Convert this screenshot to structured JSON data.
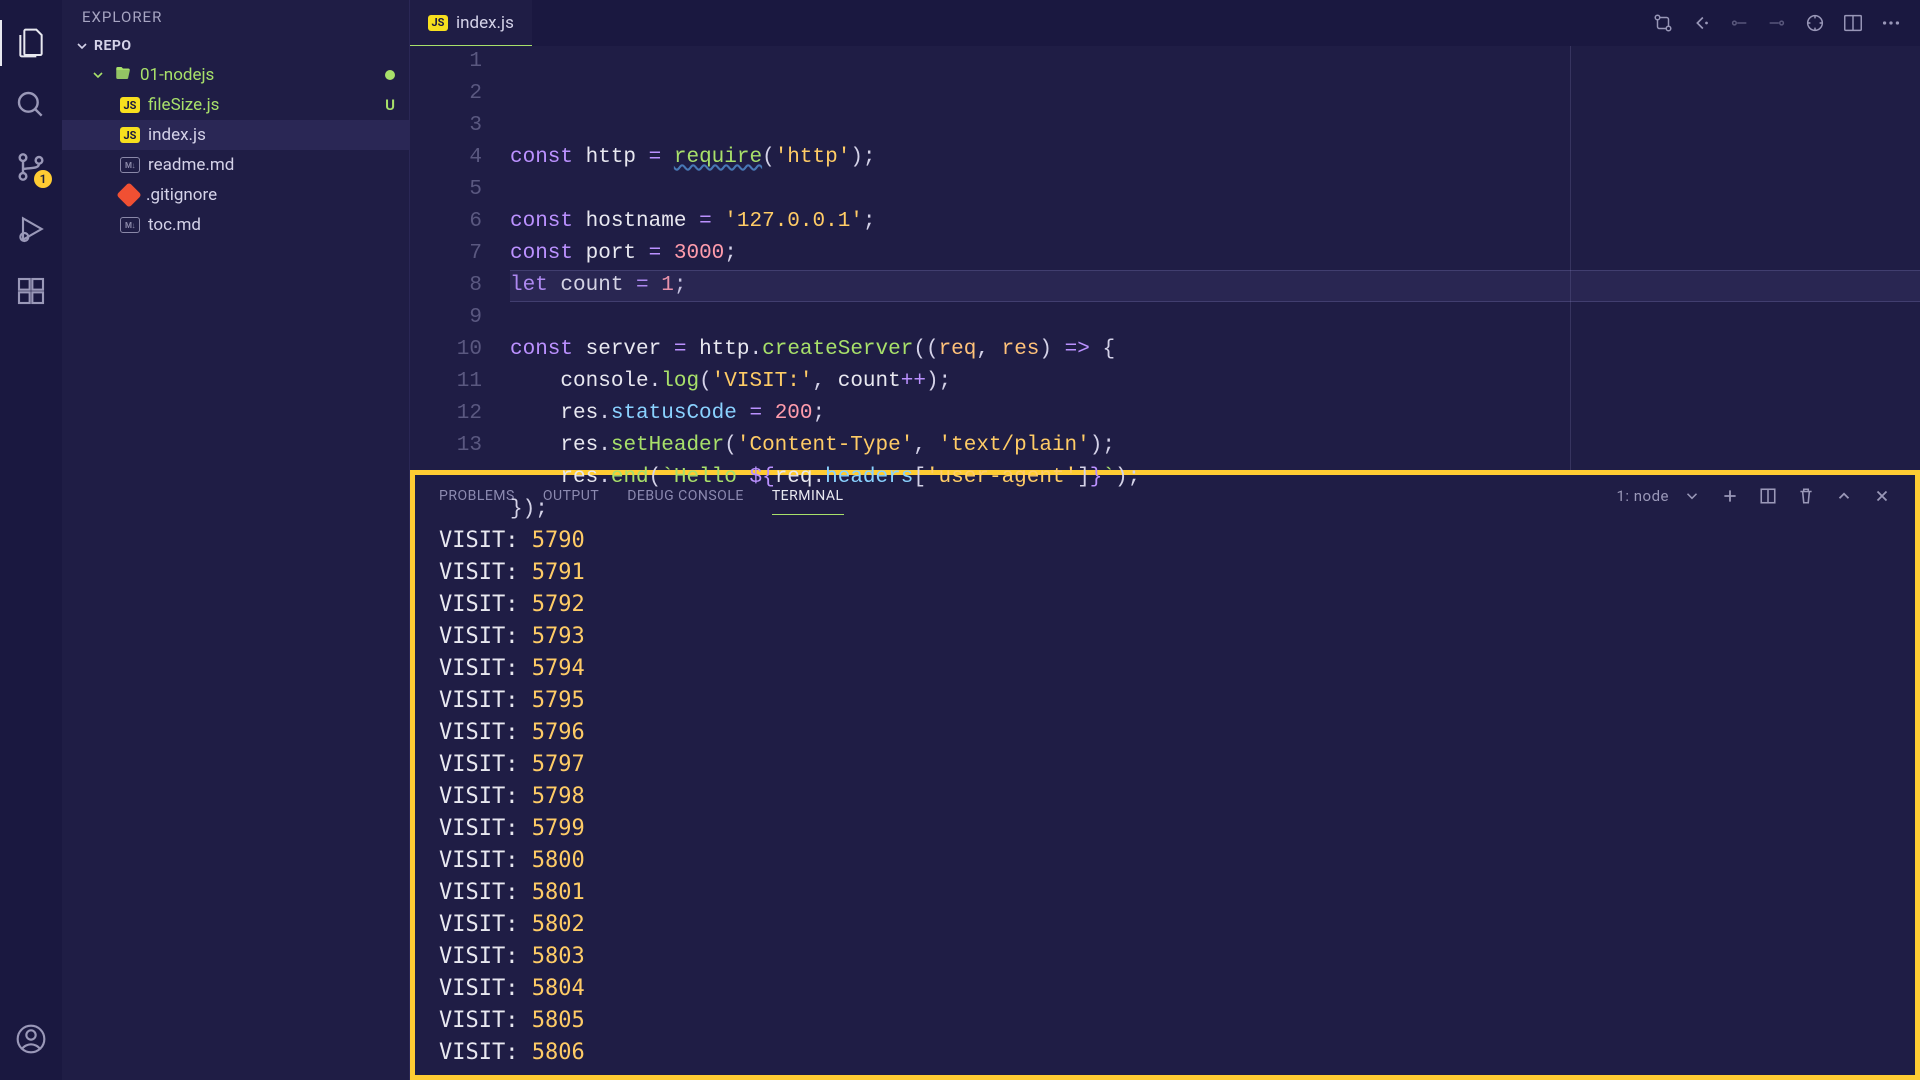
{
  "sidebar": {
    "title": "EXPLORER",
    "section": "REPO",
    "folder": "01-nodejs",
    "files": [
      {
        "icon": "js",
        "label": "fileSize.js",
        "status": "U"
      },
      {
        "icon": "js",
        "label": "index.js",
        "status": ""
      },
      {
        "icon": "md",
        "label": "readme.md",
        "status": ""
      },
      {
        "icon": "git",
        "label": ".gitignore",
        "status": ""
      },
      {
        "icon": "md",
        "label": "toc.md",
        "status": ""
      }
    ],
    "scm_badge": "1"
  },
  "tab": {
    "icon": "js",
    "label": "index.js"
  },
  "code_lines": [
    [
      {
        "t": "kw",
        "v": "const"
      },
      {
        "t": "",
        "v": " "
      },
      {
        "t": "var",
        "v": "http"
      },
      {
        "t": "",
        "v": " "
      },
      {
        "t": "op",
        "v": "="
      },
      {
        "t": "",
        "v": " "
      },
      {
        "t": "fn squig",
        "v": "require"
      },
      {
        "t": "",
        "v": "("
      },
      {
        "t": "str",
        "v": "'http'"
      },
      {
        "t": "",
        "v": ");"
      }
    ],
    [],
    [
      {
        "t": "kw",
        "v": "const"
      },
      {
        "t": "",
        "v": " "
      },
      {
        "t": "var",
        "v": "hostname"
      },
      {
        "t": "",
        "v": " "
      },
      {
        "t": "op",
        "v": "="
      },
      {
        "t": "",
        "v": " "
      },
      {
        "t": "str",
        "v": "'127.0.0.1'"
      },
      {
        "t": "",
        "v": ";"
      }
    ],
    [
      {
        "t": "kw",
        "v": "const"
      },
      {
        "t": "",
        "v": " "
      },
      {
        "t": "var",
        "v": "port"
      },
      {
        "t": "",
        "v": " "
      },
      {
        "t": "op",
        "v": "="
      },
      {
        "t": "",
        "v": " "
      },
      {
        "t": "num",
        "v": "3000"
      },
      {
        "t": "",
        "v": ";"
      }
    ],
    [
      {
        "t": "kw",
        "v": "let"
      },
      {
        "t": "",
        "v": " "
      },
      {
        "t": "var",
        "v": "count"
      },
      {
        "t": "",
        "v": " "
      },
      {
        "t": "op",
        "v": "="
      },
      {
        "t": "",
        "v": " "
      },
      {
        "t": "num",
        "v": "1"
      },
      {
        "t": "",
        "v": ";"
      }
    ],
    [],
    [
      {
        "t": "kw",
        "v": "const"
      },
      {
        "t": "",
        "v": " "
      },
      {
        "t": "var",
        "v": "server"
      },
      {
        "t": "",
        "v": " "
      },
      {
        "t": "op",
        "v": "="
      },
      {
        "t": "",
        "v": " "
      },
      {
        "t": "var",
        "v": "http"
      },
      {
        "t": "",
        "v": "."
      },
      {
        "t": "fn",
        "v": "createServer"
      },
      {
        "t": "",
        "v": "(("
      },
      {
        "t": "param",
        "v": "req"
      },
      {
        "t": "",
        "v": ", "
      },
      {
        "t": "param",
        "v": "res"
      },
      {
        "t": "",
        "v": ") "
      },
      {
        "t": "op",
        "v": "=>"
      },
      {
        "t": "",
        "v": " {"
      }
    ],
    [
      {
        "t": "",
        "v": "    "
      },
      {
        "t": "var",
        "v": "console"
      },
      {
        "t": "",
        "v": "."
      },
      {
        "t": "fn",
        "v": "log"
      },
      {
        "t": "",
        "v": "("
      },
      {
        "t": "str",
        "v": "'VISIT:'"
      },
      {
        "t": "",
        "v": ", "
      },
      {
        "t": "var",
        "v": "count"
      },
      {
        "t": "op",
        "v": "++"
      },
      {
        "t": "",
        "v": ");"
      }
    ],
    [
      {
        "t": "",
        "v": "    "
      },
      {
        "t": "var",
        "v": "res"
      },
      {
        "t": "",
        "v": "."
      },
      {
        "t": "prop",
        "v": "statusCode"
      },
      {
        "t": "",
        "v": " "
      },
      {
        "t": "op",
        "v": "="
      },
      {
        "t": "",
        "v": " "
      },
      {
        "t": "num",
        "v": "200"
      },
      {
        "t": "",
        "v": ";"
      }
    ],
    [
      {
        "t": "",
        "v": "    "
      },
      {
        "t": "var",
        "v": "res"
      },
      {
        "t": "",
        "v": "."
      },
      {
        "t": "fn",
        "v": "setHeader"
      },
      {
        "t": "",
        "v": "("
      },
      {
        "t": "str",
        "v": "'Content-Type'"
      },
      {
        "t": "",
        "v": ", "
      },
      {
        "t": "str",
        "v": "'text/plain'"
      },
      {
        "t": "",
        "v": ");"
      }
    ],
    [
      {
        "t": "",
        "v": "    "
      },
      {
        "t": "var",
        "v": "res"
      },
      {
        "t": "",
        "v": "."
      },
      {
        "t": "fn",
        "v": "end"
      },
      {
        "t": "",
        "v": "("
      },
      {
        "t": "tmpl",
        "v": "`Hello "
      },
      {
        "t": "op",
        "v": "${"
      },
      {
        "t": "var",
        "v": "req"
      },
      {
        "t": "",
        "v": "."
      },
      {
        "t": "prop",
        "v": "headers"
      },
      {
        "t": "",
        "v": "["
      },
      {
        "t": "str",
        "v": "'user-agent'"
      },
      {
        "t": "",
        "v": "]"
      },
      {
        "t": "op",
        "v": "}"
      },
      {
        "t": "tmpl",
        "v": "`"
      },
      {
        "t": "",
        "v": ");"
      }
    ],
    [
      {
        "t": "",
        "v": "});"
      }
    ],
    []
  ],
  "panel": {
    "tabs": [
      "PROBLEMS",
      "OUTPUT",
      "DEBUG CONSOLE",
      "TERMINAL"
    ],
    "active_tab": 3,
    "terminal_label": "1: node",
    "visit_prefix": "VISIT:",
    "visit_start": 5790,
    "visit_end": 5806
  },
  "colors": {
    "accent_yellow": "#ffcc33",
    "accent_green": "#a8e06a"
  }
}
